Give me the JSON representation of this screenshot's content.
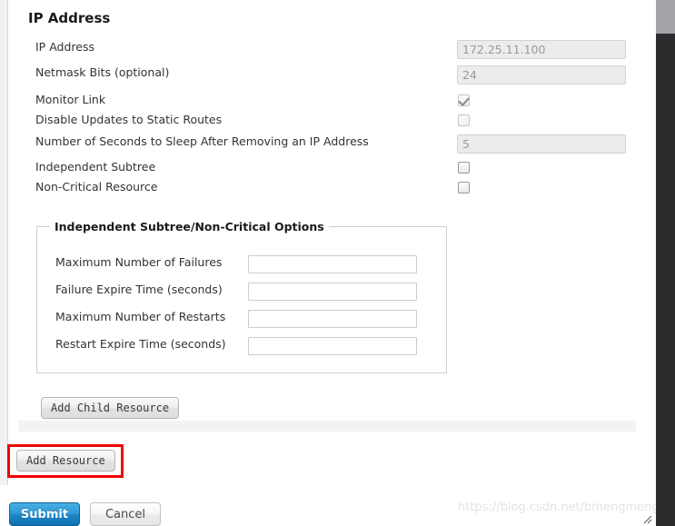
{
  "section": {
    "title": "IP Address"
  },
  "form": {
    "rows": [
      {
        "label": "IP Address",
        "type": "text",
        "value": "172.25.11.100",
        "disabled": true
      },
      {
        "label": "Netmask Bits (optional)",
        "type": "text",
        "value": "24",
        "disabled": true
      },
      {
        "label": "Monitor Link",
        "type": "checkbox",
        "checked": true,
        "disabled": true
      },
      {
        "label": "Disable Updates to Static Routes",
        "type": "checkbox",
        "checked": false,
        "disabled": true
      },
      {
        "label": "Number of Seconds to Sleep After Removing an IP Address",
        "type": "text",
        "value": "5",
        "disabled": true
      },
      {
        "label": "Independent Subtree",
        "type": "checkbox",
        "checked": false,
        "disabled": false
      },
      {
        "label": "Non-Critical Resource",
        "type": "checkbox",
        "checked": false,
        "disabled": false
      }
    ]
  },
  "options_fieldset": {
    "legend": "Independent Subtree/Non-Critical Options",
    "rows": [
      {
        "label": "Maximum Number of Failures",
        "value": ""
      },
      {
        "label": "Failure Expire Time (seconds)",
        "value": ""
      },
      {
        "label": "Maximum Number of Restarts",
        "value": ""
      },
      {
        "label": "Restart Expire Time (seconds)",
        "value": ""
      }
    ]
  },
  "buttons": {
    "add_child_resource": "Add Child Resource",
    "add_resource": "Add Resource",
    "submit": "Submit",
    "cancel": "Cancel"
  },
  "watermark": {
    "text": "https://blog.csdn.net/bmengmeng"
  },
  "colors": {
    "submit_accent": "#1d84c4",
    "annotation_highlight": "#f00000",
    "disabled_field_bg": "#ececec",
    "scrollbar_track": "#2a2c2e",
    "scrollbar_thumb": "#a3a5a8"
  }
}
